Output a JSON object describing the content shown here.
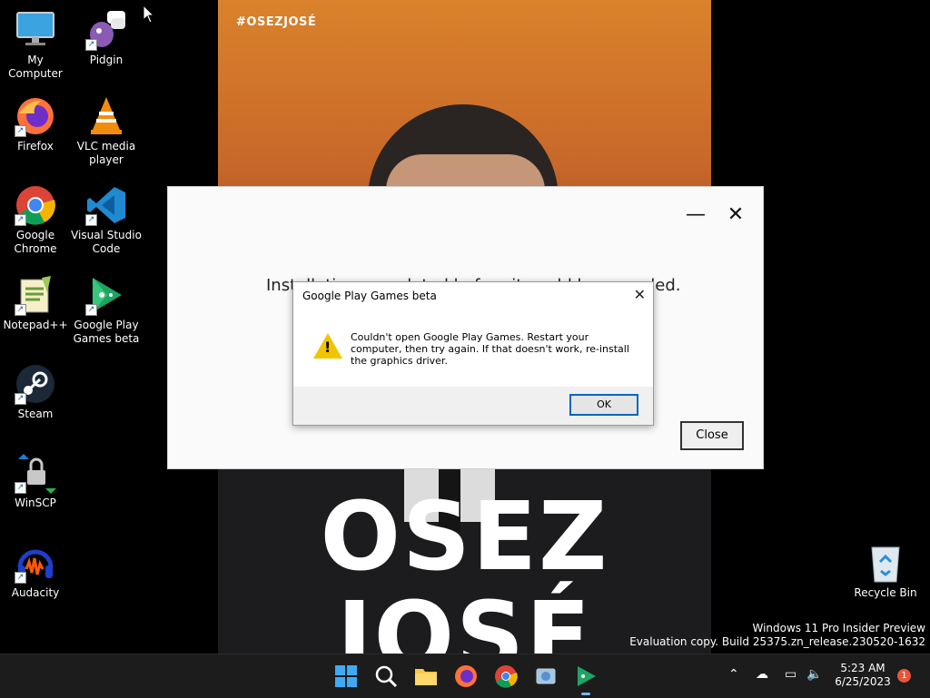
{
  "wallpaper": {
    "hashtag": "#OSEZJOSÉ",
    "headline_line1": "OSEZ",
    "headline_line2": "JOSÉ"
  },
  "desktop_icons": [
    {
      "label": "My Computer",
      "icon": "monitor-icon"
    },
    {
      "label": "Pidgin",
      "icon": "pidgin-icon"
    },
    {
      "label": "Firefox",
      "icon": "firefox-icon"
    },
    {
      "label": "VLC media player",
      "icon": "vlc-icon"
    },
    {
      "label": "Google Chrome",
      "icon": "chrome-icon"
    },
    {
      "label": "Visual Studio Code",
      "icon": "vscode-icon"
    },
    {
      "label": "Notepad++",
      "icon": "notepadpp-icon"
    },
    {
      "label": "Google Play Games beta",
      "icon": "google-play-games-icon"
    },
    {
      "label": "Steam",
      "icon": "steam-icon"
    },
    {
      "label": "WinSCP",
      "icon": "winscp-icon"
    },
    {
      "label": "Audacity",
      "icon": "audacity-icon"
    },
    {
      "label": "Recycle Bin",
      "icon": "recycle-bin-icon"
    }
  ],
  "installer": {
    "message": "Installation completed before it could be recorded.",
    "minimize_glyph": "—",
    "close_glyph": "✕",
    "close_button": "Close"
  },
  "dialog": {
    "title": "Google Play Games beta",
    "close_glyph": "✕",
    "message": "Couldn't open Google Play Games. Restart your computer, then try again. If that doesn't work, re-install the graphics driver.",
    "ok_button": "OK"
  },
  "watermark": {
    "line1": "Windows 11 Pro Insider Preview",
    "line2": "Evaluation copy. Build 25375.zn_release.230520-1632"
  },
  "taskbar": {
    "time": "5:23 AM",
    "date": "6/25/2023",
    "notification_count": "1",
    "pinned": [
      "start-icon",
      "search-icon",
      "file-explorer-icon",
      "firefox-icon",
      "chrome-icon",
      "control-panel-icon",
      "google-play-games-icon"
    ]
  },
  "colors": {
    "accent": "#0067c0",
    "warning": "#f2c400",
    "taskbar": "#1c1c1c"
  }
}
